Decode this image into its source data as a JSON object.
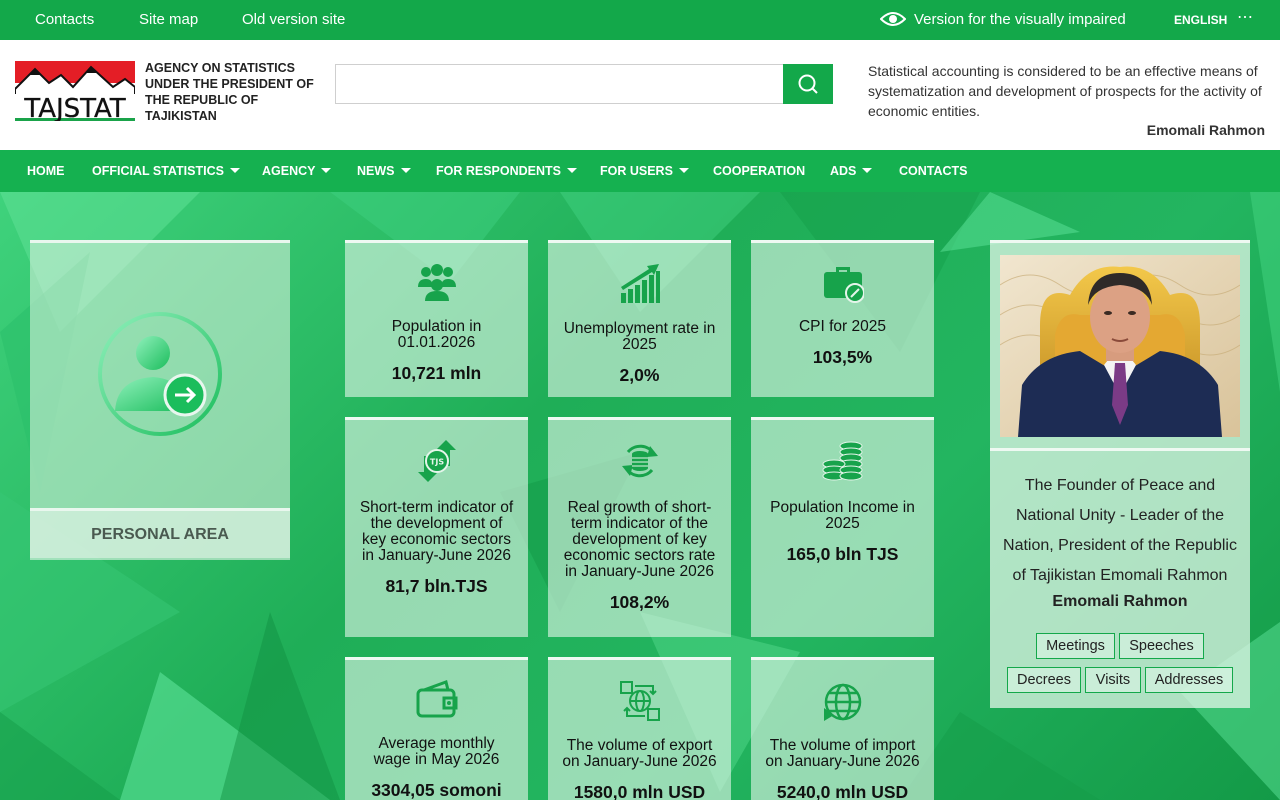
{
  "topbar": {
    "links": [
      "Contacts",
      "Site map",
      "Old version site"
    ],
    "visually_impaired": "Version for the visually impaired",
    "language": "ENGLISH",
    "more": "⋯",
    "color": "#13a84a"
  },
  "header": {
    "logo_text": "TAJSTAT",
    "agency_name": "AGENCY ON STATISTICS UNDER THE PRESIDENT OF THE REPUBLIC OF TAJIKISTAN",
    "search_placeholder": "",
    "quote": "Statistical accounting is considered to be an effective means of systematization and development of prospects for the activity of economic entities.",
    "quote_author": "Emomali Rahmon"
  },
  "nav": {
    "items": [
      {
        "label": "HOME",
        "dropdown": false
      },
      {
        "label": "OFFICIAL STATISTICS",
        "dropdown": true
      },
      {
        "label": "AGENCY",
        "dropdown": true
      },
      {
        "label": "NEWS",
        "dropdown": true
      },
      {
        "label": "FOR RESPONDENTS",
        "dropdown": true
      },
      {
        "label": "FOR USERS",
        "dropdown": true
      },
      {
        "label": "COOPERATION",
        "dropdown": false
      },
      {
        "label": "ADS",
        "dropdown": true
      },
      {
        "label": "CONTACTS",
        "dropdown": false
      }
    ]
  },
  "personal_area": {
    "label": "PERSONAL AREA",
    "icon": "user-login-icon"
  },
  "cards": [
    {
      "icon": "population-icon",
      "label": "Population in 01.01.2026",
      "value": "10,721 mln"
    },
    {
      "icon": "growth-chart-icon",
      "label": "Unemployment rate in 2025",
      "value": "2,0%"
    },
    {
      "icon": "briefcase-percent-icon",
      "label": "CPI for 2025",
      "value": "103,5%"
    },
    {
      "icon": "currency-exchange-icon",
      "label": "Short-term indicator of the development of key economic sectors in January-June 2026",
      "value": "81,7 bln.TJS"
    },
    {
      "icon": "coin-cycle-icon",
      "label": "Real growth of short-term indicator of the development of key economic sectors rate in January-June 2026",
      "value": "108,2%"
    },
    {
      "icon": "coin-stack-icon",
      "label": "Population Income in 2025",
      "value": "165,0 bln TJS"
    },
    {
      "icon": "wallet-icon",
      "label": "Average monthly wage in May 2026",
      "value": "3304,05 somoni"
    },
    {
      "icon": "export-icon",
      "label": "The volume of export on January-June 2026",
      "value": "1580,0 mln USD"
    },
    {
      "icon": "globe-import-icon",
      "label": "The volume of import on January-June 2026",
      "value": "5240,0 mln USD"
    }
  ],
  "president": {
    "caption": "The Founder of Peace and National Unity - Leader of the Nation, President of the Republic of Tajikistan Emomali Rahmon",
    "name": "Emomali Rahmon",
    "tags": [
      "Meetings",
      "Speeches",
      "Decrees",
      "Visits",
      "Addresses"
    ]
  }
}
